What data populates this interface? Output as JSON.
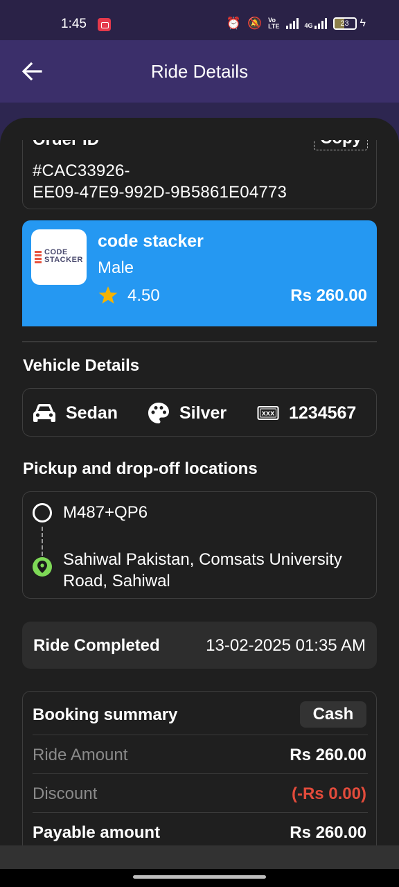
{
  "status_bar": {
    "time": "1:45",
    "network_label": "4G",
    "volte_label_top": "Vo",
    "volte_label_bottom": "LTE",
    "battery_level": "23"
  },
  "app_bar": {
    "title": "Ride Details"
  },
  "order": {
    "label": "Order ID",
    "copy_label": "Copy",
    "id_line1": "#CAC33926-",
    "id_line2": "EE09-47E9-992D-9B5861E04773"
  },
  "driver": {
    "logo_text_line1": "CODE",
    "logo_text_line2": "STACKER",
    "name": "code stacker",
    "gender": "Male",
    "rating": "4.50",
    "price": "Rs 260.00",
    "card_color": "#2598f2"
  },
  "vehicle": {
    "heading": "Vehicle Details",
    "type": "Sedan",
    "color": "Silver",
    "plate": "1234567",
    "plate_icon_text": "XXX"
  },
  "route": {
    "heading": "Pickup and drop-off locations",
    "pickup": "M487+QP6",
    "dropoff": "Sahiwal Pakistan, Comsats University Road, Sahiwal"
  },
  "status": {
    "label": "Ride Completed",
    "datetime": "13-02-2025 01:35 AM"
  },
  "summary": {
    "title": "Booking summary",
    "payment_method": "Cash",
    "rows": [
      {
        "label": "Ride Amount",
        "value": "Rs 260.00"
      },
      {
        "label": "Discount",
        "value": "(-Rs 0.00)"
      },
      {
        "label": "Payable amount",
        "value": "Rs 260.00"
      }
    ]
  },
  "colors": {
    "app_bar": "#3b2f6a",
    "background": "#1f1f1f",
    "accent_blue": "#2598f2",
    "discount_red": "#e24b3b",
    "star": "#f5b301",
    "pin_green": "#7ed957"
  }
}
